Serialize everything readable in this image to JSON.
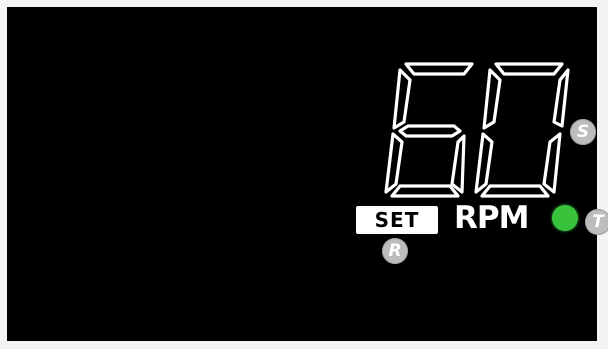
{
  "display": {
    "value": "60",
    "unit": "RPM",
    "set_label": "SET"
  },
  "badges": {
    "s": "S",
    "t": "T",
    "r": "R"
  },
  "indicator": {
    "status": "on",
    "color": "#39c33c"
  },
  "colors": {
    "screen": "#000000",
    "text": "#ffffff",
    "badge": "#bdbdbd"
  }
}
